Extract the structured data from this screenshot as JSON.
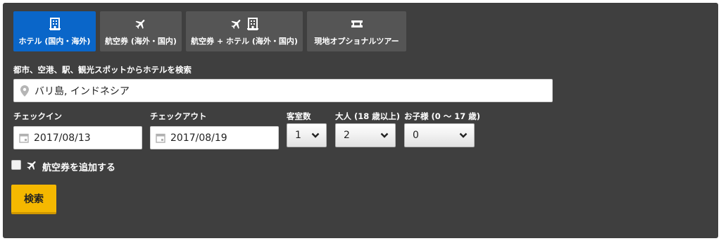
{
  "tabs": [
    {
      "label": "ホテル (国内・海外)",
      "icons": [
        "hotel-icon"
      ],
      "active": true
    },
    {
      "label": "航空券 (海外・国内)",
      "icons": [
        "plane-icon"
      ],
      "active": false
    },
    {
      "label": "航空券 + ホテル (海外・国内)",
      "icons": [
        "plane-icon",
        "hotel-icon"
      ],
      "active": false
    },
    {
      "label": "現地オプショナルツアー",
      "icons": [
        "ticket-icon"
      ],
      "active": false
    }
  ],
  "destination": {
    "label": "都市、空港、駅、観光スポットからホテルを検索",
    "value": "バリ島, インドネシア",
    "icon": "map-pin-icon"
  },
  "checkin": {
    "label": "チェックイン",
    "value": "2017/08/13",
    "icon": "calendar-icon"
  },
  "checkout": {
    "label": "チェックアウト",
    "value": "2017/08/19",
    "icon": "calendar-icon"
  },
  "rooms": {
    "label": "客室数",
    "value": "1"
  },
  "adults": {
    "label": "大人 (18 歳以上)",
    "value": "2"
  },
  "children": {
    "label": "お子様 (0 ～ 17 歳)",
    "value": "0"
  },
  "add_flight": {
    "label": "航空券を追加する",
    "checked": false,
    "icon": "plane-icon"
  },
  "search_button": {
    "label": "検索"
  },
  "colors": {
    "panel": "#3f3f3f",
    "tab": "#555555",
    "active_tab": "#0a66c9",
    "search_button": "#f5b800"
  }
}
